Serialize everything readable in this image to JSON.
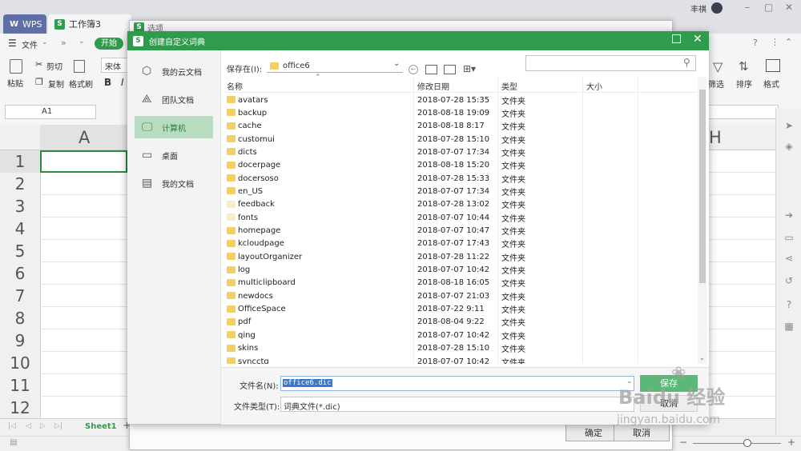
{
  "app": {
    "tab_wps": "WPS",
    "tab_doc": "工作簿3",
    "user_name": "丰祺"
  },
  "menu": {
    "file": "文件",
    "start": "开始"
  },
  "ribbon": {
    "cut": "剪切",
    "copy": "复制",
    "paste": "粘贴",
    "format_painter": "格式刷",
    "font_name": "宋体",
    "filter": "筛选",
    "sort": "排序",
    "format": "格式"
  },
  "formula": {
    "cell_ref": "A1"
  },
  "sheet": {
    "columns": [
      "A",
      "H"
    ],
    "rows": [
      "1",
      "2",
      "3",
      "4",
      "5",
      "6",
      "7",
      "8",
      "9",
      "10",
      "11",
      "12"
    ],
    "sheet_tab": "Sheet1"
  },
  "options_dialog": {
    "title": "选项",
    "ok": "确定",
    "cancel": "取消"
  },
  "dialog": {
    "title": "创建自定义词典",
    "nav": [
      {
        "label": "我的云文档",
        "icon": "cube-icon"
      },
      {
        "label": "团队文档",
        "icon": "team-icon"
      },
      {
        "label": "计算机",
        "icon": "computer-icon"
      },
      {
        "label": "桌面",
        "icon": "desktop-icon"
      },
      {
        "label": "我的文档",
        "icon": "my-docs-icon"
      }
    ],
    "look_in_label": "保存在(I):",
    "look_in_value": "office6",
    "columns": {
      "name": "名称",
      "date": "修改日期",
      "type": "类型",
      "size": "大小"
    },
    "files": [
      {
        "name": "avatars",
        "date": "2018-07-28 15:35",
        "type": "文件夹"
      },
      {
        "name": "backup",
        "date": "2018-08-18 19:09",
        "type": "文件夹"
      },
      {
        "name": "cache",
        "date": "2018-08-18 8:17",
        "type": "文件夹"
      },
      {
        "name": "customui",
        "date": "2018-07-28 15:10",
        "type": "文件夹"
      },
      {
        "name": "dicts",
        "date": "2018-07-07 17:34",
        "type": "文件夹"
      },
      {
        "name": "docerpage",
        "date": "2018-08-18 15:20",
        "type": "文件夹"
      },
      {
        "name": "docersoso",
        "date": "2018-07-28 15:33",
        "type": "文件夹"
      },
      {
        "name": "en_US",
        "date": "2018-07-07 17:34",
        "type": "文件夹"
      },
      {
        "name": "feedback",
        "date": "2018-07-28 13:02",
        "type": "文件夹"
      },
      {
        "name": "fonts",
        "date": "2018-07-07 10:44",
        "type": "文件夹"
      },
      {
        "name": "homepage",
        "date": "2018-07-07 10:47",
        "type": "文件夹"
      },
      {
        "name": "kcloudpage",
        "date": "2018-07-07 17:43",
        "type": "文件夹"
      },
      {
        "name": "layoutOrganizer",
        "date": "2018-07-28 11:22",
        "type": "文件夹"
      },
      {
        "name": "log",
        "date": "2018-07-07 10:42",
        "type": "文件夹"
      },
      {
        "name": "multiclipboard",
        "date": "2018-08-18 16:05",
        "type": "文件夹"
      },
      {
        "name": "newdocs",
        "date": "2018-07-07 21:03",
        "type": "文件夹"
      },
      {
        "name": "OfficeSpace",
        "date": "2018-07-22 9:11",
        "type": "文件夹"
      },
      {
        "name": "pdf",
        "date": "2018-08-04 9:22",
        "type": "文件夹"
      },
      {
        "name": "qing",
        "date": "2018-07-07 10:42",
        "type": "文件夹"
      },
      {
        "name": "skins",
        "date": "2018-07-28 15:10",
        "type": "文件夹"
      },
      {
        "name": "syncctg",
        "date": "2018-07-07 10:42",
        "type": "文件夹"
      }
    ],
    "filename_label": "文件名(N):",
    "filename_value": "office6.dic",
    "filetype_label": "文件类型(T):",
    "filetype_value": "词典文件(*.dic)",
    "save_button": "保存",
    "cancel_button": "取消"
  },
  "watermark": {
    "text": "Baidu 经验",
    "url_text": "jingyan.baidu.com"
  },
  "colors": {
    "accent_green": "#2f9c4d",
    "nav_active": "#b7dcc0",
    "selection_blue": "#3b78c9"
  }
}
